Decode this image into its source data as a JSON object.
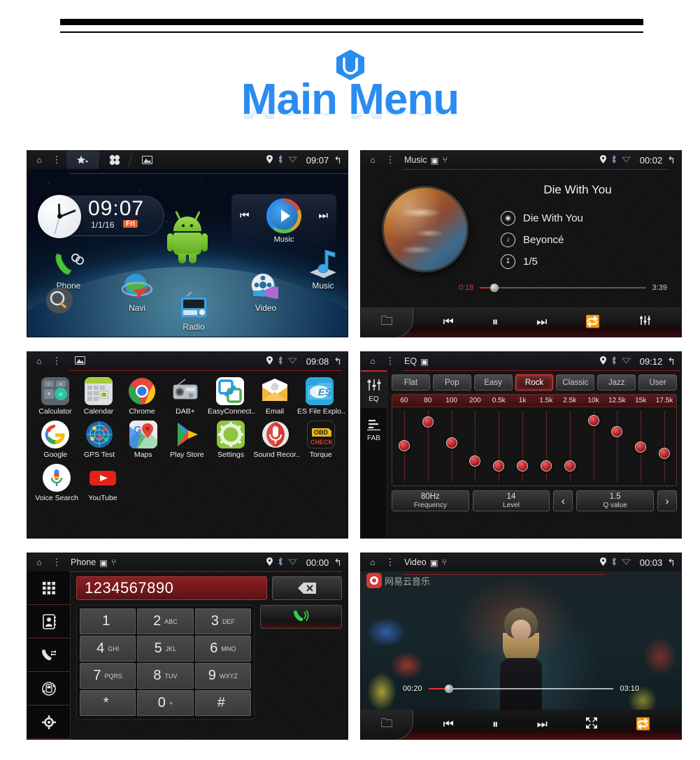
{
  "header": {
    "logo_alt": "ui-hexagon-logo",
    "title": "Main Menu"
  },
  "screens": {
    "home": {
      "statusbar": {
        "home_icon": "home-icon",
        "menu_icon": "overflow-menu-icon",
        "tabs": [
          "favorites-icon",
          "apps-grid-icon",
          "wallpaper-icon"
        ],
        "gps_icon": "location-pin-icon",
        "bt_icon": "bluetooth-icon",
        "wifi_icon": "wifi-icon",
        "time": "09:07",
        "back_icon": "back-arrow-icon"
      },
      "clock": {
        "time": "09:07",
        "date": "1/1/16",
        "day": "Fri"
      },
      "music_widget": {
        "label": "Music",
        "prev": "prev-track-icon",
        "play": "play-icon",
        "next": "next-track-icon"
      },
      "shortcuts": [
        {
          "label": "Phone",
          "icon": "phone-handset-icon"
        },
        {
          "label": "Navi",
          "icon": "navigation-globe-icon"
        },
        {
          "label": "Radio",
          "icon": "radio-icon"
        },
        {
          "label": "Video",
          "icon": "film-reel-icon"
        },
        {
          "label": "Music",
          "icon": "music-note-icon"
        },
        {
          "label": "",
          "icon": "search-magnifier-icon"
        }
      ]
    },
    "music": {
      "statusbar": {
        "title": "Music",
        "sd_icon": "sd-card-icon",
        "usb_icon": "usb-icon",
        "time": "00:02"
      },
      "track_title": "Die With You",
      "meta": [
        {
          "icon": "disc-icon",
          "value": "Die With You"
        },
        {
          "icon": "artist-icon",
          "value": "Beyoncé"
        },
        {
          "icon": "playlist-icon",
          "value": "1/5"
        }
      ],
      "progress": {
        "current": "0:18",
        "total": "3:39",
        "percent": 8
      },
      "controls": [
        "folder-icon",
        "previous-icon",
        "pause-icon",
        "next-icon",
        "repeat-icon",
        "equalizer-icon"
      ]
    },
    "apps": {
      "statusbar": {
        "time": "09:08",
        "wallpaper_icon": "wallpaper-icon"
      },
      "items": [
        {
          "label": "Calculator",
          "icon": "calculator-icon"
        },
        {
          "label": "Calendar",
          "icon": "calendar-icon"
        },
        {
          "label": "Chrome",
          "icon": "chrome-icon"
        },
        {
          "label": "DAB+",
          "icon": "dab-radio-icon"
        },
        {
          "label": "EasyConnect..",
          "icon": "easyconnect-icon"
        },
        {
          "label": "Email",
          "icon": "email-icon"
        },
        {
          "label": "ES File Explo..",
          "icon": "es-file-explorer-icon"
        },
        {
          "label": "Google",
          "icon": "google-icon"
        },
        {
          "label": "GPS Test",
          "icon": "gps-test-icon"
        },
        {
          "label": "Maps",
          "icon": "maps-icon"
        },
        {
          "label": "Play Store",
          "icon": "play-store-icon"
        },
        {
          "label": "Settings",
          "icon": "settings-gear-icon"
        },
        {
          "label": "Sound Recor..",
          "icon": "sound-recorder-icon"
        },
        {
          "label": "Torque",
          "icon": "torque-obd-icon"
        },
        {
          "label": "Voice Search",
          "icon": "voice-search-mic-icon"
        },
        {
          "label": "YouTube",
          "icon": "youtube-icon"
        }
      ]
    },
    "eq": {
      "statusbar": {
        "title": "EQ",
        "sd_icon": "sd-card-icon",
        "time": "09:12"
      },
      "sidebar": [
        {
          "label": "EQ",
          "icon": "equalizer-sliders-icon",
          "active": true
        },
        {
          "label": "FAB",
          "icon": "fader-balance-icon",
          "active": false
        }
      ],
      "presets": [
        "Flat",
        "Pop",
        "Easy",
        "Rock",
        "Classic",
        "Jazz",
        "User"
      ],
      "active_preset": "Rock",
      "bands": [
        "60",
        "80",
        "100",
        "200",
        "0.5k",
        "1k",
        "1.5k",
        "2.5k",
        "10k",
        "12.5k",
        "15k",
        "17.5k"
      ],
      "band_positions": [
        42,
        12,
        38,
        62,
        68,
        68,
        68,
        68,
        10,
        24,
        44,
        52
      ],
      "footer": [
        {
          "value": "80Hz",
          "key": "Frequency"
        },
        {
          "value": "14",
          "key": "Level"
        },
        {
          "value": "1.5",
          "key": "Q value"
        }
      ],
      "prev_arrow": "chevron-left-icon",
      "next_arrow": "chevron-right-icon"
    },
    "phone": {
      "statusbar": {
        "title": "Phone",
        "sd_icon": "sd-card-icon",
        "usb_icon": "usb-icon",
        "time": "00:00"
      },
      "sidebar": [
        "dialpad-icon",
        "contacts-book-icon",
        "call-log-icon",
        "sync-contacts-icon",
        "settings-gear-icon"
      ],
      "number": "1234567890",
      "delete_icon": "backspace-icon",
      "call_icon": "call-green-icon",
      "keys": [
        {
          "digit": "1",
          "sub": ""
        },
        {
          "digit": "2",
          "sub": "ABC"
        },
        {
          "digit": "3",
          "sub": "DEF"
        },
        {
          "digit": "4",
          "sub": "GHI"
        },
        {
          "digit": "5",
          "sub": "JKL"
        },
        {
          "digit": "6",
          "sub": "MNO"
        },
        {
          "digit": "7",
          "sub": "PQRS"
        },
        {
          "digit": "8",
          "sub": "TUV"
        },
        {
          "digit": "9",
          "sub": "WXYZ"
        },
        {
          "digit": "*",
          "sub": ""
        },
        {
          "digit": "0",
          "sub": "+"
        },
        {
          "digit": "#",
          "sub": ""
        }
      ]
    },
    "video": {
      "statusbar": {
        "title": "Video",
        "sd_icon": "sd-card-icon",
        "usb_icon": "usb-icon",
        "time": "00:03"
      },
      "watermark": "网易云音乐",
      "progress": {
        "current": "00:20",
        "total": "03:10",
        "percent": 10
      },
      "controls": [
        "folder-icon",
        "previous-icon",
        "pause-icon",
        "next-icon",
        "fullscreen-icon",
        "repeat-icon"
      ]
    }
  },
  "colors": {
    "accent_blue": "#2a8cf0",
    "accent_red": "#d42b26",
    "status_bar": "#1b1c20"
  }
}
